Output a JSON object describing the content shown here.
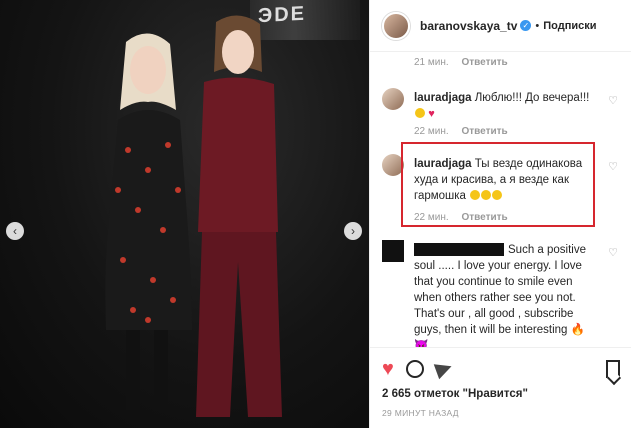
{
  "post": {
    "sign_text": "ЭDE"
  },
  "header": {
    "username": "baranovskaya_tv",
    "dot": "•",
    "follow": "Подписки"
  },
  "comments": [
    {
      "kind": "meta",
      "time": "21 мин.",
      "reply": "Ответить"
    },
    {
      "kind": "comment",
      "user": "lauradjaga",
      "text": "Люблю!!! До вечера!!!",
      "time": "22 мин.",
      "reply": "Ответить"
    },
    {
      "kind": "comment",
      "user": "lauradjaga",
      "text": "Ты везде одинакова худа и красива, а я везде как гармошка",
      "time": "22 мин.",
      "reply": "Ответить"
    },
    {
      "kind": "comment",
      "user": "",
      "text": "Such a positive soul ..... I love your energy. I love that you continue to smile even when others rather see you not. That's our , all good , subscribe guys, then it will be interesting"
    }
  ],
  "actions": {
    "likes": "2 665 отметок \"Нравится\"",
    "time_ago": "29 МИНУТ НАЗАД"
  },
  "colors": {
    "accent": "#3897f0",
    "like_red": "#ed4956",
    "highlight_box": "#d6262e"
  }
}
